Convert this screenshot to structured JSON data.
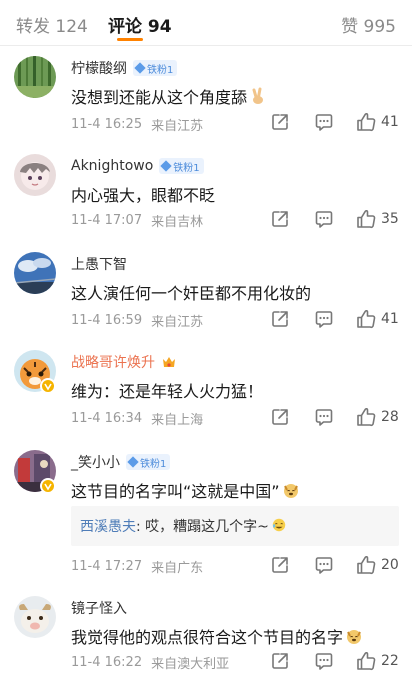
{
  "tabs": {
    "repost_label": "转发 124",
    "comments_label": "评论 94",
    "likes_label": "赞 995",
    "accent_color": "#ff8200"
  },
  "comments": [
    {
      "username": "柠檬酸纲",
      "badge": "铁粉1",
      "text": "没想到还能从这个角度舔",
      "emoji": "victory-hand-emoji",
      "date": "11-4 16:25",
      "source": "来自江苏",
      "likes": "41"
    },
    {
      "username": "Aknightowo",
      "badge": "铁粉1",
      "text": "内心强大，眼都不眨",
      "date": "11-4 17:07",
      "source": "来自吉林",
      "likes": "35"
    },
    {
      "username": "上愚下智",
      "text": "这人演任何一个奸臣都不用化妆的",
      "date": "11-4 16:59",
      "source": "来自江苏",
      "likes": "41"
    },
    {
      "username": "战略哥许焕升",
      "text": "维为：还是年轻人火力猛！",
      "date": "11-4 16:34",
      "source": "来自上海",
      "likes": "28"
    },
    {
      "username": "_笑小小",
      "badge": "铁粉1",
      "text": "这节目的名字叫“这就是中国”",
      "emoji": "smiling-dog-emoji",
      "reply_author": "西溪愚夫",
      "reply_text": ": 哎，糟蹋这几个字~",
      "date": "11-4 17:27",
      "source": "来自广东",
      "likes": "20"
    },
    {
      "username": "镜子怪入",
      "text": "我觉得他的观点很符合这个节目的名字",
      "emoji": "smiling-dog-emoji",
      "date": "11-4 16:22",
      "source": "来自澳大利亚",
      "likes": "22"
    }
  ]
}
